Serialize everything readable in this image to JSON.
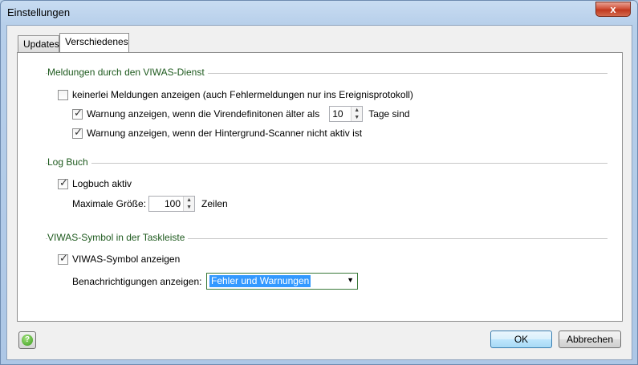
{
  "window": {
    "title": "Einstellungen",
    "close_glyph": "x"
  },
  "tabs": [
    {
      "label": "Updates"
    },
    {
      "label": "Verschiedenes"
    }
  ],
  "groups": {
    "viwas": {
      "title": "Meldungen durch den VIWAS-Dienst",
      "no_messages": {
        "label": "keinerlei Meldungen anzeigen (auch Fehlermeldungen nur ins Ereignisprotokoll)",
        "checked": false
      },
      "warn_defs": {
        "label": "Warnung anzeigen, wenn die Virendefinitonen älter als",
        "checked": true,
        "value": "10",
        "suffix": "Tage sind"
      },
      "warn_scanner": {
        "label": "Warnung anzeigen, wenn der Hintergrund-Scanner nicht aktiv ist",
        "checked": true
      }
    },
    "log": {
      "title": "Log Buch",
      "active": {
        "label": "Logbuch aktiv",
        "checked": true
      },
      "max_size": {
        "label": "Maximale Größe:",
        "value": "100",
        "suffix": "Zeilen"
      }
    },
    "tray": {
      "title": "VIWAS-Symbol in der Taskleiste",
      "show_icon": {
        "label": "VIWAS-Symbol anzeigen",
        "checked": true
      },
      "notifications": {
        "label": "Benachrichtigungen anzeigen:",
        "selected": "Fehler und Warnungen"
      }
    }
  },
  "buttons": {
    "ok": "OK",
    "cancel": "Abbrechen",
    "help_glyph": "?"
  },
  "colors": {
    "group_title": "#1e5a1e",
    "selection": "#3399ff"
  }
}
